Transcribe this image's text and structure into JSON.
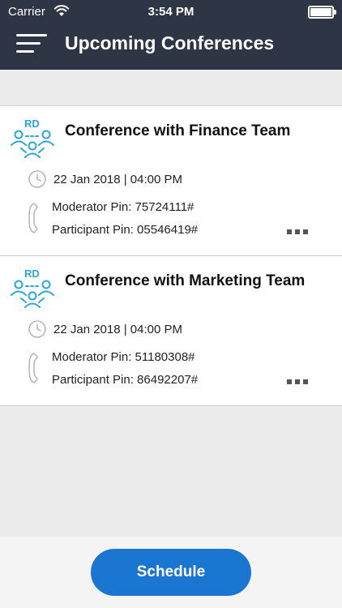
{
  "status_bar": {
    "carrier": "Carrier",
    "time": "3:54 PM"
  },
  "header": {
    "title": "Upcoming Conferences"
  },
  "conferences": [
    {
      "badge": "RD",
      "title": "Conference with Finance Team",
      "datetime": "22 Jan 2018 | 04:00 PM",
      "moderator_pin": "Moderator Pin: 75724111#",
      "participant_pin": "Participant Pin: 05546419#"
    },
    {
      "badge": "RD",
      "title": "Conference with Marketing Team",
      "datetime": "22 Jan 2018 | 04:00 PM",
      "moderator_pin": "Moderator Pin: 51180308#",
      "participant_pin": "Participant Pin: 86492207#"
    }
  ],
  "footer": {
    "schedule_label": "Schedule"
  },
  "colors": {
    "header_bg": "#2e3545",
    "accent": "#1a76d0",
    "icon_blue": "#2aa7d8"
  }
}
